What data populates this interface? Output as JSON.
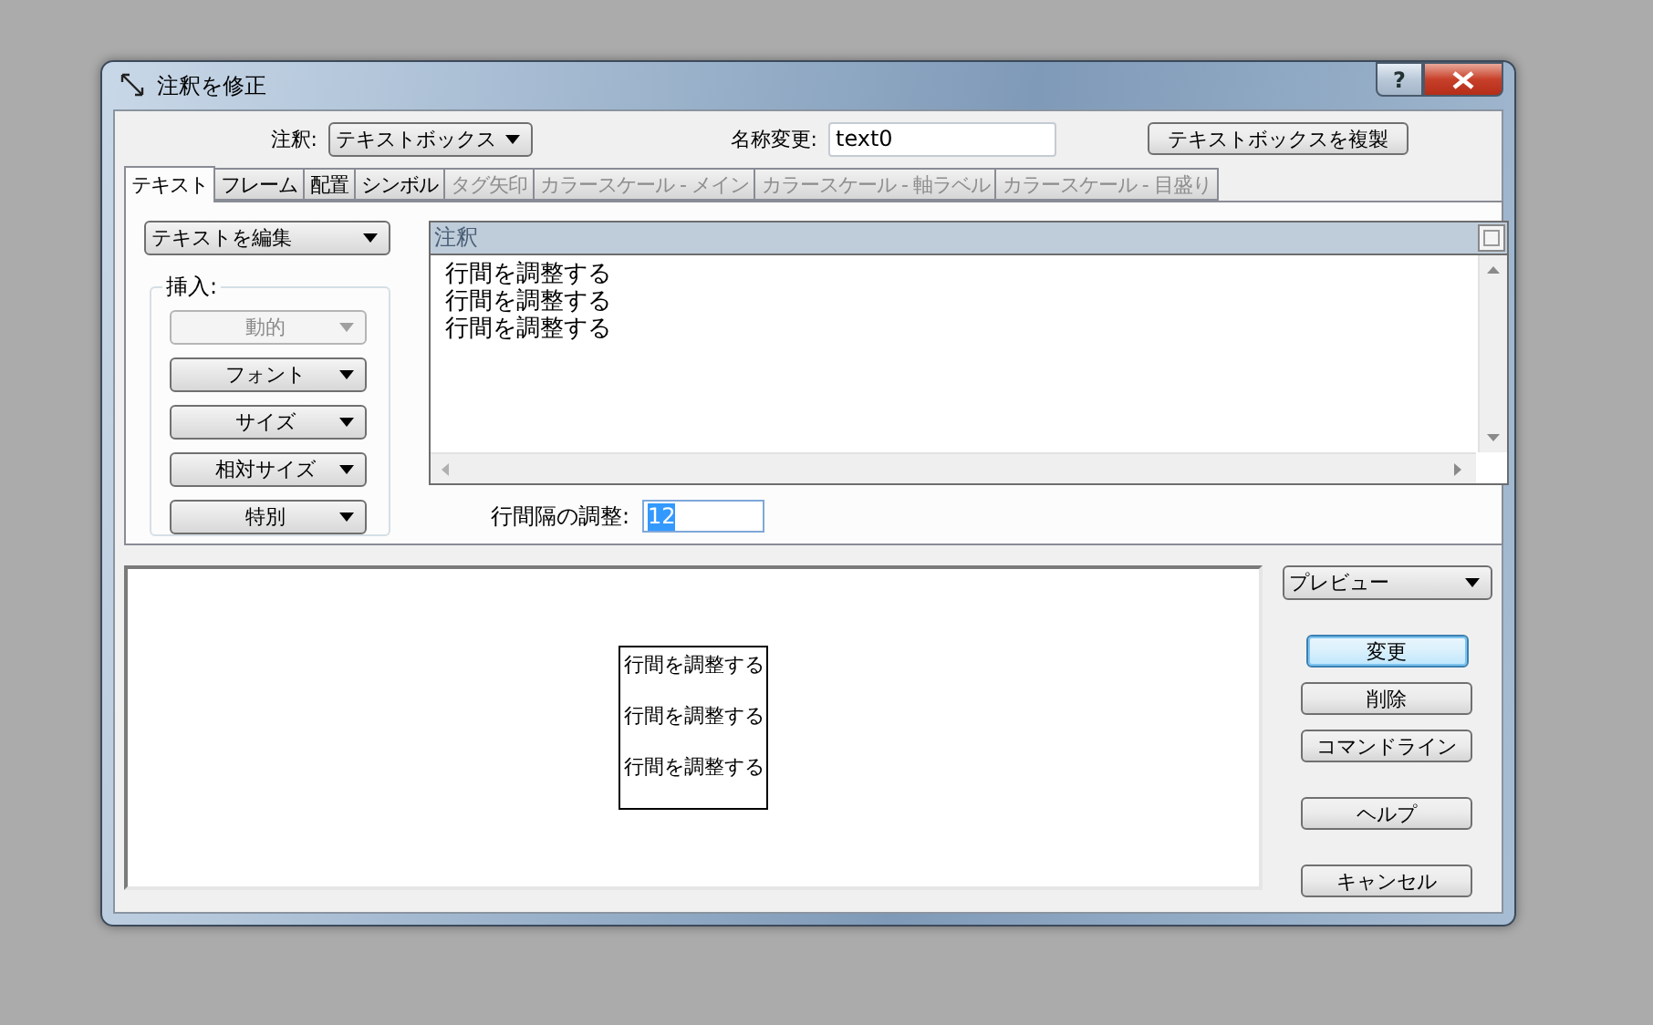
{
  "window": {
    "title": "注釈を修正",
    "help": "?"
  },
  "annotation": {
    "label": "注釈:",
    "value": "テキストボックス"
  },
  "rename": {
    "label": "名称変更:",
    "value": "text0"
  },
  "duplicate_button": "テキストボックスを複製",
  "tabs": [
    {
      "label": "テキスト",
      "selected": true,
      "disabled": false
    },
    {
      "label": "フレーム",
      "selected": false,
      "disabled": false
    },
    {
      "label": "配置",
      "selected": false,
      "disabled": false
    },
    {
      "label": "シンボル",
      "selected": false,
      "disabled": false
    },
    {
      "label": "タグ矢印",
      "selected": false,
      "disabled": true
    },
    {
      "label": "カラースケール - メイン",
      "selected": false,
      "disabled": true
    },
    {
      "label": "カラースケール - 軸ラベル",
      "selected": false,
      "disabled": true
    },
    {
      "label": "カラースケール - 目盛り",
      "selected": false,
      "disabled": true
    }
  ],
  "edit_mode": "テキストを編集",
  "insert": {
    "legend": "挿入:",
    "buttons": [
      {
        "label": "動的",
        "disabled": true
      },
      {
        "label": "フォント",
        "disabled": false
      },
      {
        "label": "サイズ",
        "disabled": false
      },
      {
        "label": "相対サイズ",
        "disabled": false
      },
      {
        "label": "特別",
        "disabled": false
      }
    ]
  },
  "editor": {
    "header": "注釈",
    "lines": [
      "行間を調整する",
      "行間を調整する",
      "行間を調整する"
    ]
  },
  "line_spacing": {
    "label": "行間隔の調整:",
    "value": "12",
    "value_selected": true
  },
  "preview": {
    "lines": [
      "行間を調整する",
      "行間を調整する",
      "行間を調整する"
    ]
  },
  "view_mode": "プレビュー",
  "action_groups": [
    [
      {
        "label": "変更",
        "default": true
      },
      {
        "label": "削除",
        "default": false
      },
      {
        "label": "コマンドライン",
        "default": false
      }
    ],
    [
      {
        "label": "ヘルプ",
        "default": false
      }
    ],
    [
      {
        "label": "キャンセル",
        "default": false
      }
    ]
  ]
}
